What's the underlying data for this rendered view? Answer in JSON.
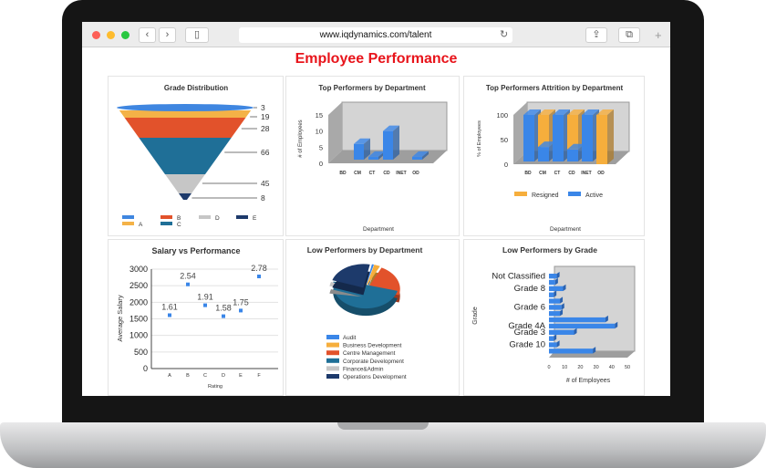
{
  "browser": {
    "url": "www.iqdynamics.com/talent",
    "back_icon": "chevron-left",
    "forward_icon": "chevron-right",
    "sidebar_icon": "sidebar",
    "reload_icon": "reload",
    "share_icon": "share",
    "tabs_icon": "tabs",
    "new_tab_icon": "plus",
    "traffic_lights": {
      "close": "#fd5f57",
      "minimize": "#febc2e",
      "zoom": "#28c840"
    }
  },
  "page": {
    "title": "Employee Performance"
  },
  "chart_data": [
    {
      "type": "funnel",
      "title": "Grade Distribution",
      "values": [
        3,
        19,
        28,
        66,
        45,
        8
      ],
      "legend": [
        "",
        "A",
        "B",
        "C",
        "D",
        "E"
      ],
      "colors": [
        "#3f86e0",
        "#f4b247",
        "#e2522b",
        "#1f6f97",
        "#c6c6c6",
        "#1d3a6b"
      ]
    },
    {
      "type": "bar",
      "title": "Top Performers by Department",
      "categories": [
        "BD",
        "CM",
        "CT",
        "CD",
        "INET",
        "OD"
      ],
      "values": [
        1,
        6,
        2,
        10,
        1,
        2
      ],
      "xlabel": "Department",
      "ylabel": "# of Employees",
      "ylim": [
        0,
        15
      ],
      "yticks": [
        0,
        5,
        10,
        15
      ],
      "color": "#3a86e8"
    },
    {
      "type": "bar",
      "stacked": true,
      "title": "Top Performers Attrition by Department",
      "categories": [
        "BD",
        "CM",
        "CT",
        "CD",
        "INET",
        "OD"
      ],
      "series": [
        {
          "name": "Active",
          "values": [
            100,
            35,
            100,
            30,
            100,
            0
          ],
          "color": "#3a86e8"
        },
        {
          "name": "Resigned",
          "values": [
            0,
            65,
            0,
            70,
            0,
            100
          ],
          "color": "#f6ae3c"
        }
      ],
      "legend_order": [
        "Resigned",
        "Active"
      ],
      "xlabel": "Department",
      "ylabel": "% of Employees",
      "ylim": [
        0,
        100
      ],
      "yticks": [
        0,
        50,
        100
      ]
    },
    {
      "type": "scatter",
      "title": "Salary vs Performance",
      "categories": [
        "A",
        "B",
        "C",
        "D",
        "E",
        "F"
      ],
      "values": [
        1610,
        2540,
        1910,
        1580,
        1750,
        2780
      ],
      "labels": [
        "1.61",
        "2.54",
        "1.91",
        "1.58",
        "1.75",
        "2.78"
      ],
      "xlabel": "Rating",
      "ylabel": "Average Salary",
      "ylim": [
        0,
        3000
      ],
      "yticks": [
        0,
        500,
        1000,
        1500,
        2000,
        2500,
        3000
      ],
      "grid": true,
      "color": "#3a86e8"
    },
    {
      "type": "pie",
      "title": "Low Performers by Department",
      "legend": [
        "Audit",
        "Business Development",
        "Centre Management",
        "Corporate Development",
        "Finance&Admin",
        "Operations Development"
      ],
      "values": [
        1,
        3,
        22,
        48,
        3,
        23
      ],
      "colors": [
        "#3a86e8",
        "#f6ae3c",
        "#e2522b",
        "#1f6f97",
        "#c6c6c6",
        "#1d3a6b"
      ]
    },
    {
      "type": "bar",
      "orientation": "horizontal",
      "title": "Low Performers by Grade",
      "categories": [
        "Not Classified",
        "",
        "Grade 8",
        "",
        "",
        "Grade 6",
        "",
        "",
        "Grade 4A",
        "Grade 3",
        "",
        "Grade 10",
        ""
      ],
      "values": [
        5,
        4,
        9,
        3,
        7,
        8,
        7,
        36,
        42,
        16,
        3,
        5,
        28
      ],
      "xlabel": "# of Employees",
      "ylabel": "Grade",
      "xlim": [
        0,
        50
      ],
      "xticks": [
        0,
        10,
        20,
        30,
        40,
        50
      ],
      "color": "#3a86e8"
    }
  ]
}
